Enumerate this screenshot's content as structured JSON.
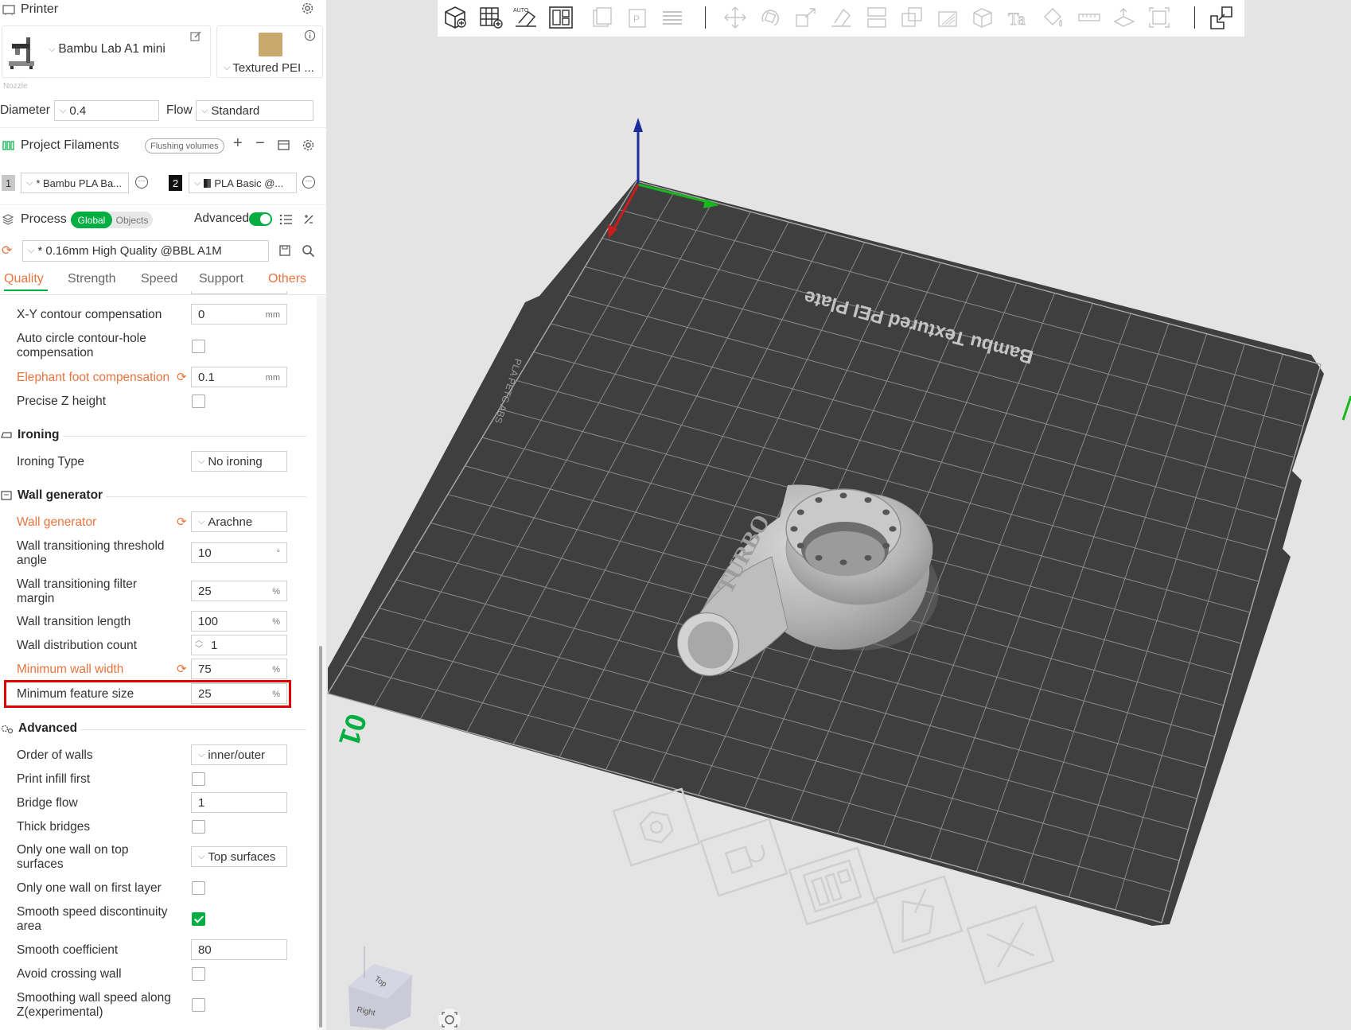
{
  "printer": {
    "section_title": "Printer",
    "name": "Bambu Lab A1 mini",
    "plate": "Textured PEI ...",
    "nozzle_caption": "Nozzle",
    "diameter_label": "Diameter",
    "diameter_value": "0.4",
    "flow_label": "Flow",
    "flow_value": "Standard"
  },
  "filaments": {
    "section_title": "Project Filaments",
    "flushing_label": "Flushing volumes",
    "items": [
      {
        "index": "1",
        "name": "* Bambu PLA Ba...",
        "color": "#c8c8c8"
      },
      {
        "index": "2",
        "name": "PLA Basic @...",
        "color": "#111111"
      }
    ]
  },
  "process": {
    "section_title": "Process",
    "global_label": "Global",
    "objects_label": "Objects",
    "advanced_label": "Advanced",
    "preset": "* 0.16mm High Quality @BBL A1M",
    "tabs": [
      "Quality",
      "Strength",
      "Speed",
      "Support",
      "Others"
    ]
  },
  "settings": {
    "xy_contour": {
      "label": "X-Y contour compensation",
      "value": "0",
      "unit": "mm"
    },
    "auto_circle": {
      "label1": "Auto circle contour-hole",
      "label2": "compensation"
    },
    "elephant_foot": {
      "label": "Elephant foot compensation",
      "value": "0.1",
      "unit": "mm"
    },
    "precise_z": {
      "label": "Precise Z height"
    },
    "ironing_group": "Ironing",
    "ironing_type": {
      "label": "Ironing Type",
      "value": "No ironing"
    },
    "wall_group": "Wall generator",
    "wall_generator": {
      "label": "Wall generator",
      "value": "Arachne"
    },
    "wall_trans_angle": {
      "label1": "Wall transitioning threshold",
      "label2": "angle",
      "value": "10",
      "unit": "°"
    },
    "wall_trans_filter": {
      "label1": "Wall transitioning filter",
      "label2": "margin",
      "value": "25",
      "unit": "%"
    },
    "wall_trans_length": {
      "label": "Wall transition length",
      "value": "100",
      "unit": "%"
    },
    "wall_dist_count": {
      "label": "Wall distribution count",
      "value": "1"
    },
    "min_wall_width": {
      "label": "Minimum wall width",
      "value": "75",
      "unit": "%"
    },
    "min_feature_size": {
      "label": "Minimum feature size",
      "value": "25",
      "unit": "%"
    },
    "advanced_group": "Advanced",
    "order_walls": {
      "label": "Order of walls",
      "value": "inner/outer"
    },
    "print_infill_first": {
      "label": "Print infill first"
    },
    "bridge_flow": {
      "label": "Bridge flow",
      "value": "1"
    },
    "thick_bridges": {
      "label": "Thick bridges"
    },
    "one_wall_top": {
      "label1": "Only one wall on top",
      "label2": "surfaces",
      "value": "Top surfaces"
    },
    "one_wall_first": {
      "label": "Only one wall on first layer"
    },
    "smooth_speed": {
      "label1": "Smooth speed discontinuity",
      "label2": "area"
    },
    "smooth_coeff": {
      "label": "Smooth coefficient",
      "value": "80"
    },
    "avoid_crossing": {
      "label": "Avoid crossing wall"
    },
    "smoothing_wall_z": {
      "label1": "Smoothing wall speed along",
      "label2": "Z(experimental)"
    }
  },
  "viewport": {
    "plate_text": "Bambu Textured PEI Plate",
    "plate_number": "01",
    "side_text": "PLA PETG ABS",
    "model_text": "TURBO",
    "cube_top": "Top",
    "cube_right": "Right",
    "accent": "#00ae42",
    "modified_color": "#e9743f",
    "highlight_color": "#e00000"
  }
}
